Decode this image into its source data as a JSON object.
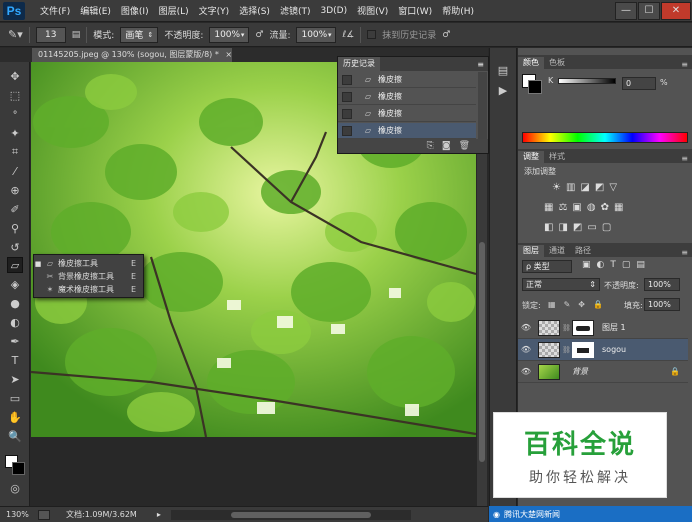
{
  "app": {
    "logo": "Ps"
  },
  "menu": [
    "文件(F)",
    "编辑(E)",
    "图像(I)",
    "图层(L)",
    "文字(Y)",
    "选择(S)",
    "滤镜(T)",
    "3D(D)",
    "视图(V)",
    "窗口(W)",
    "帮助(H)"
  ],
  "window_buttons": {
    "minimize": "—",
    "restore": "☐",
    "close": "✕"
  },
  "options": {
    "brush_size": "13",
    "mode_label": "模式:",
    "mode_value": "画笔",
    "opacity_label": "不透明度:",
    "opacity_value": "100%",
    "flow_label": "流量:",
    "flow_value": "100%",
    "erase_history_label": "抹到历史记录"
  },
  "document": {
    "tab_title": "01145205.jpeg @ 130% (sogou, 图层蒙版/8) *",
    "tab_close": "×"
  },
  "status": {
    "zoom": "130%",
    "doc_info": "文档:1.09M/3.62M"
  },
  "flyout": {
    "items": [
      {
        "label": "橡皮擦工具",
        "key": "E",
        "active": true
      },
      {
        "label": "背景橡皮擦工具",
        "key": "E",
        "active": false
      },
      {
        "label": "魔术橡皮擦工具",
        "key": "E",
        "active": false
      }
    ]
  },
  "history": {
    "title": "历史记录",
    "rows": [
      {
        "label": "橡皮擦"
      },
      {
        "label": "橡皮擦"
      },
      {
        "label": "橡皮擦"
      },
      {
        "label": "橡皮擦"
      }
    ]
  },
  "color_panel": {
    "tabs": [
      "颜色",
      "色板"
    ],
    "channel": "K",
    "value": "0",
    "unit": "%"
  },
  "adjust_panel": {
    "tabs": [
      "调整",
      "样式"
    ],
    "title": "添加调整"
  },
  "layers_panel": {
    "tabs": [
      "图层",
      "通道",
      "路径"
    ],
    "filter_label": "ρ 类型",
    "blend_mode": "正常",
    "opacity_label": "不透明度:",
    "opacity_value": "100%",
    "lock_label": "锁定:",
    "fill_label": "填充:",
    "fill_value": "100%",
    "layers": [
      {
        "name": "图层 1",
        "selected": false
      },
      {
        "name": "sogou",
        "selected": true
      },
      {
        "name": "背景",
        "selected": false
      }
    ]
  },
  "watermark": {
    "title": "百科全说",
    "subtitle": "助你轻松解决"
  },
  "news": {
    "label": "腾讯大楚网新闻"
  }
}
